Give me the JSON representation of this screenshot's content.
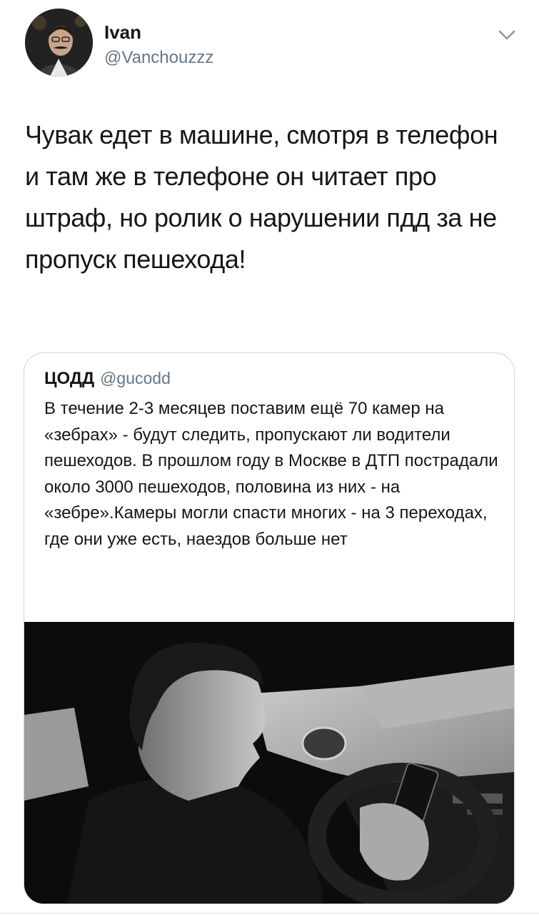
{
  "tweet": {
    "display_name": "Ivan",
    "handle": "@Vanchouzzz",
    "text": "Чувак едет в машине, смотря в телефон и там же в телефоне он читает про штраф, но ролик о нарушении пдд за не пропуск пешехода!",
    "menu_icon": "chevron-down-icon"
  },
  "quoted_tweet": {
    "display_name": "ЦОДД",
    "handle": "@gucodd",
    "text": "В течение 2-3 месяцев поставим ещё 70 камер на «зебрах» - будут следить, пропускают ли водители пешеходов. В прошлом году в Москве в ДТП пострадали около 3000 пешеходов, половина из них - на «зебре».Камеры могли спасти многих - на 3 переходах, где они уже есть, наездов больше нет"
  },
  "colors": {
    "text_primary": "#14171a",
    "text_secondary": "#657786",
    "border": "#ccd6dd"
  }
}
